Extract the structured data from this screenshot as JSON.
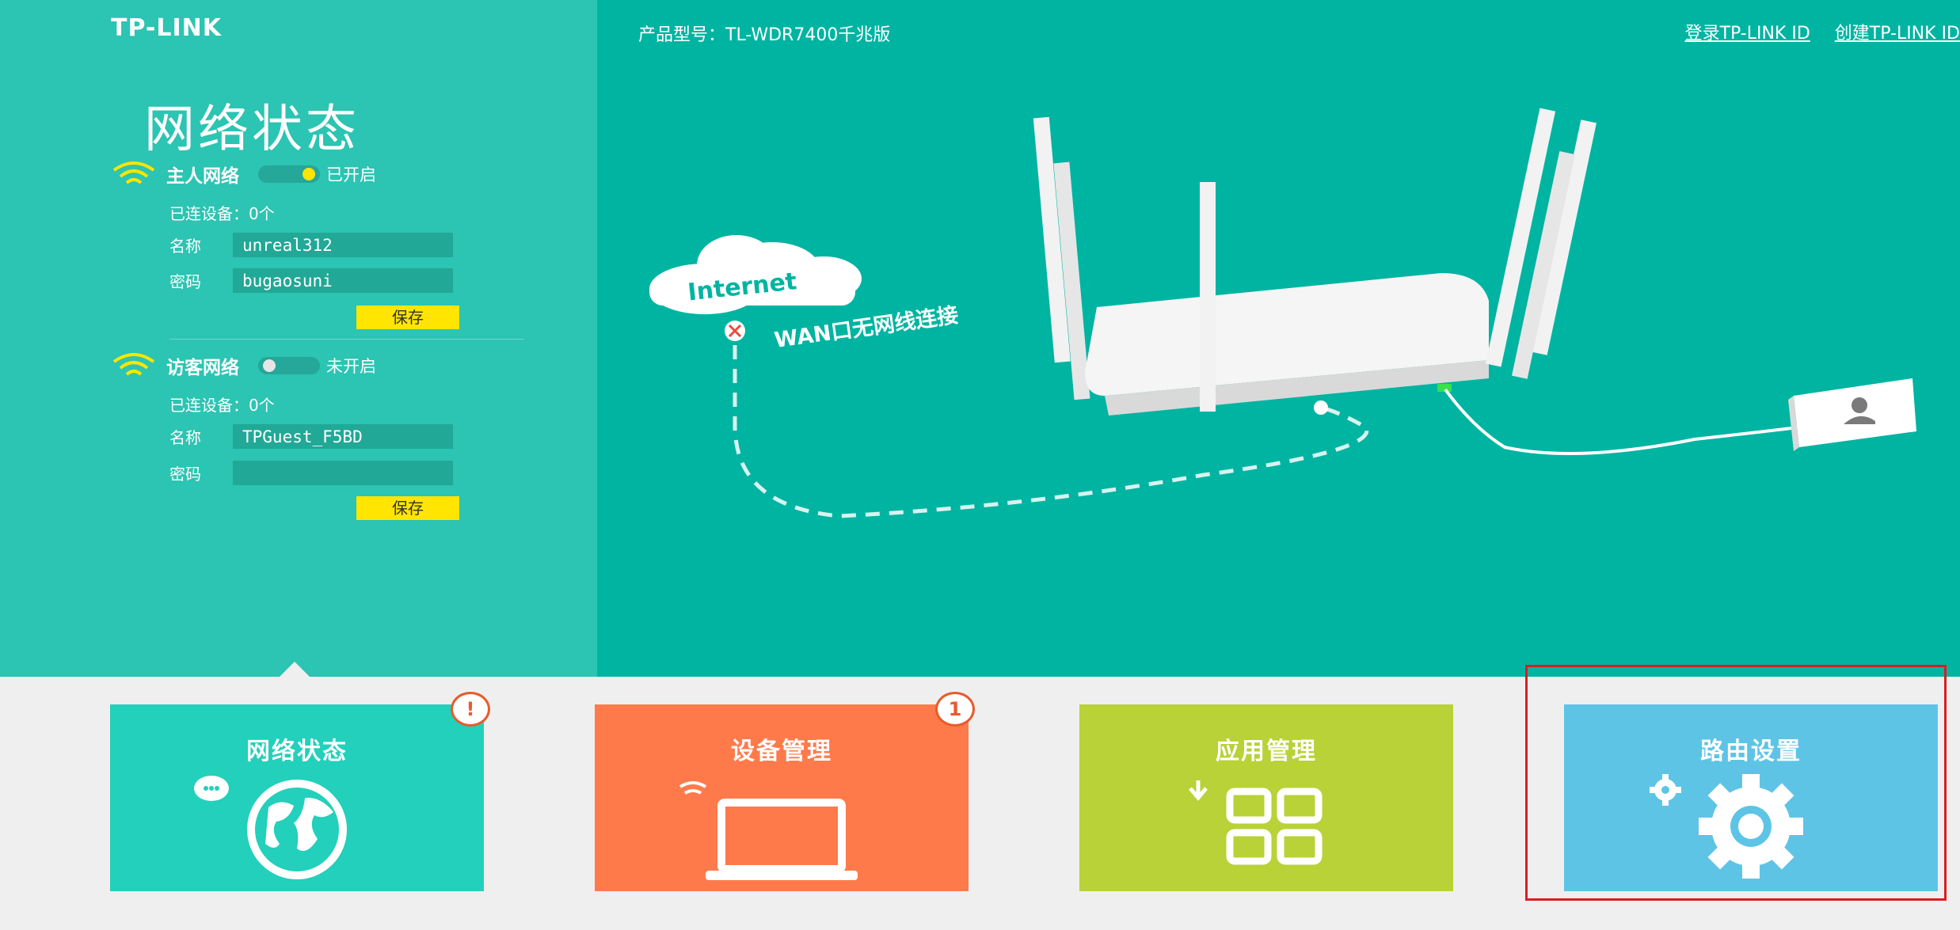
{
  "header": {
    "logo": "TP-LINK",
    "model": "产品型号：TL-WDR7400千兆版",
    "links": [
      "登录TP-LINK ID",
      "创建TP-LINK ID"
    ]
  },
  "page_title": "网络状态",
  "main_network": {
    "title": "主人网络",
    "toggle_state": "已开启",
    "connected": "已连设备：0个",
    "name_label": "名称",
    "name_value": "unreal312",
    "password_label": "密码",
    "password_value": "bugaosuni",
    "save_label": "保存"
  },
  "guest_network": {
    "title": "访客网络",
    "toggle_state": "未开启",
    "connected": "已连设备：0个",
    "name_label": "名称",
    "name_value": "TPGuest_F5BD",
    "password_label": "密码",
    "password_value": "",
    "save_label": "保存"
  },
  "diagram": {
    "internet_label": "Internet",
    "wan_status": "WAN口无网线连接"
  },
  "tiles": [
    {
      "label": "网络状态",
      "badge": "!",
      "color": "#22d0bb"
    },
    {
      "label": "设备管理",
      "badge": "1",
      "color": "#ff7a4b"
    },
    {
      "label": "应用管理",
      "badge": "",
      "color": "#b8d237"
    },
    {
      "label": "路由设置",
      "badge": "",
      "color": "#5ec4e6"
    }
  ],
  "colors": {
    "hero_bg": "#00b4a2",
    "left_panel_bg": "#2cc4b2",
    "accent_yellow": "#ffe500",
    "highlight_red": "#d91f1f"
  }
}
